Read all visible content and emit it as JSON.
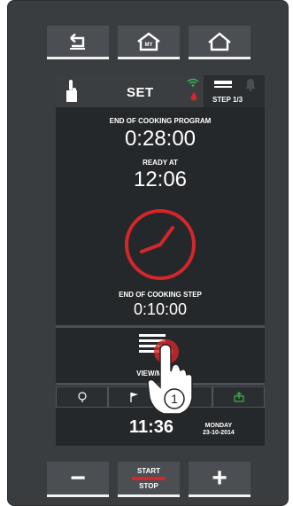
{
  "nav": {
    "back_icon": "back-arrow-icon",
    "my_home_icon": "my-home-icon",
    "my_home_text": "MY",
    "home_icon": "home-icon"
  },
  "header": {
    "title": "SET",
    "step": "STEP 1/3"
  },
  "program": {
    "end_label": "END OF COOKING PROGRAM",
    "end_time": "0:28:00",
    "ready_label": "READY AT",
    "ready_time": "12:06",
    "step_label": "END OF COOKING STEP",
    "step_time": "0:10:00"
  },
  "view": {
    "label": "VIEW/MODIFY"
  },
  "footer": {
    "clock": "11:36",
    "day": "MONDAY",
    "date": "23-10-2014"
  },
  "controls": {
    "minus": "−",
    "start": "START",
    "stop": "STOP",
    "plus": "+"
  },
  "annotation": {
    "number": "1"
  },
  "colors": {
    "accent": "#d4262b",
    "wifi": "#3fb24d",
    "screen": "#25282a",
    "device": "#3a3d40"
  }
}
